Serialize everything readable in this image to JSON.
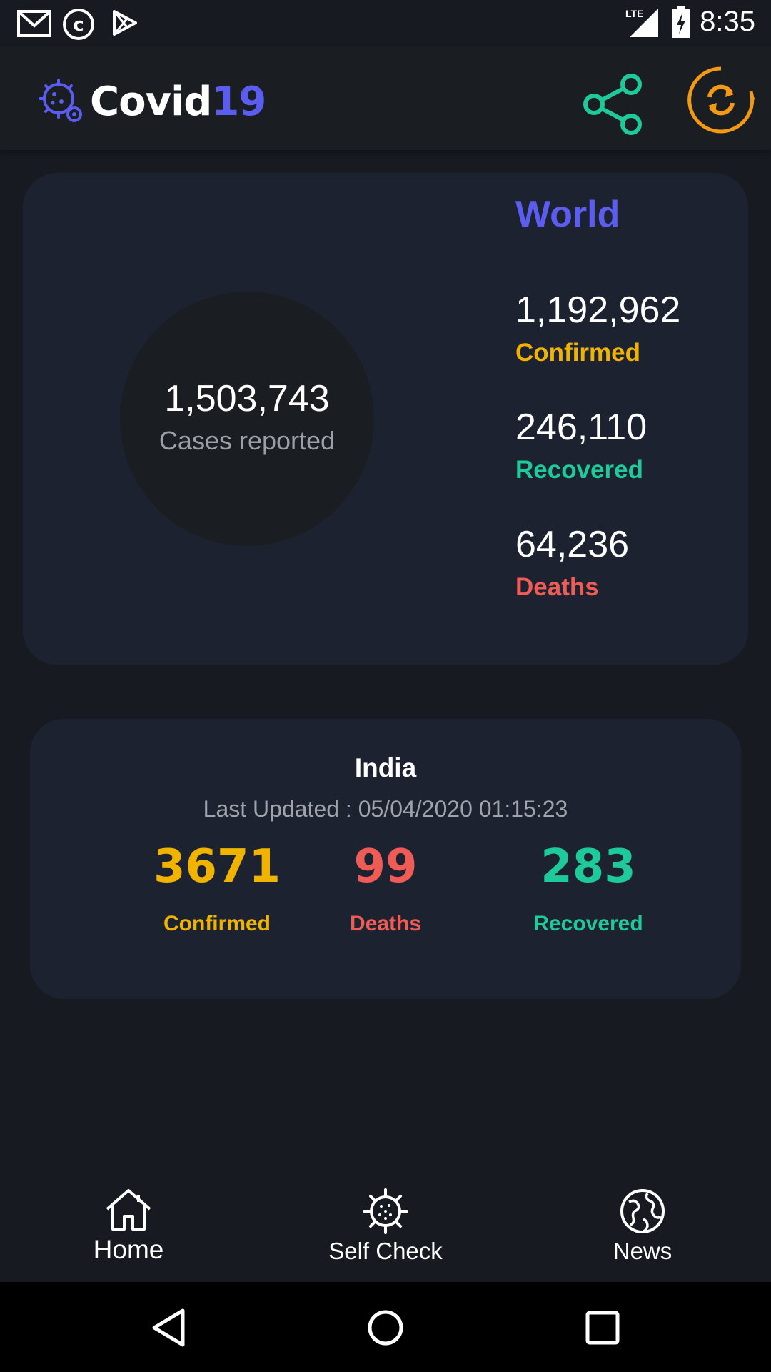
{
  "status_bar": {
    "time": "8:35",
    "network": "LTE",
    "icons": [
      "gmail-icon",
      "c-circle-icon",
      "play-store-icon",
      "signal-icon",
      "battery-charging-icon"
    ]
  },
  "header": {
    "title_main": "Covid",
    "title_accent": "19",
    "icons": [
      "virus-gear-logo-icon",
      "share-icon",
      "refresh-icon"
    ]
  },
  "world": {
    "title": "World",
    "total_cases": "1,503,743",
    "total_label": "Cases reported",
    "confirmed": "1,192,962",
    "confirmed_label": "Confirmed",
    "recovered": "246,110",
    "recovered_label": "Recovered",
    "deaths": "64,236",
    "deaths_label": "Deaths"
  },
  "india": {
    "title": "India",
    "last_updated": "Last Updated : 05/04/2020 01:15:23",
    "confirmed": "3671",
    "confirmed_label": "Confirmed",
    "deaths": "99",
    "deaths_label": "Deaths",
    "recovered": "283",
    "recovered_label": "Recovered"
  },
  "nav": {
    "home": "Home",
    "self_check": "Self Check",
    "news": "News"
  },
  "colors": {
    "accent": "#5b5cf0",
    "confirmed": "#f0b400",
    "recovered": "#1ec99a",
    "deaths": "#ef5b55",
    "refresh": "#f39a14",
    "share": "#1ec99a",
    "card": "#1d2230",
    "background": "#171b21"
  }
}
